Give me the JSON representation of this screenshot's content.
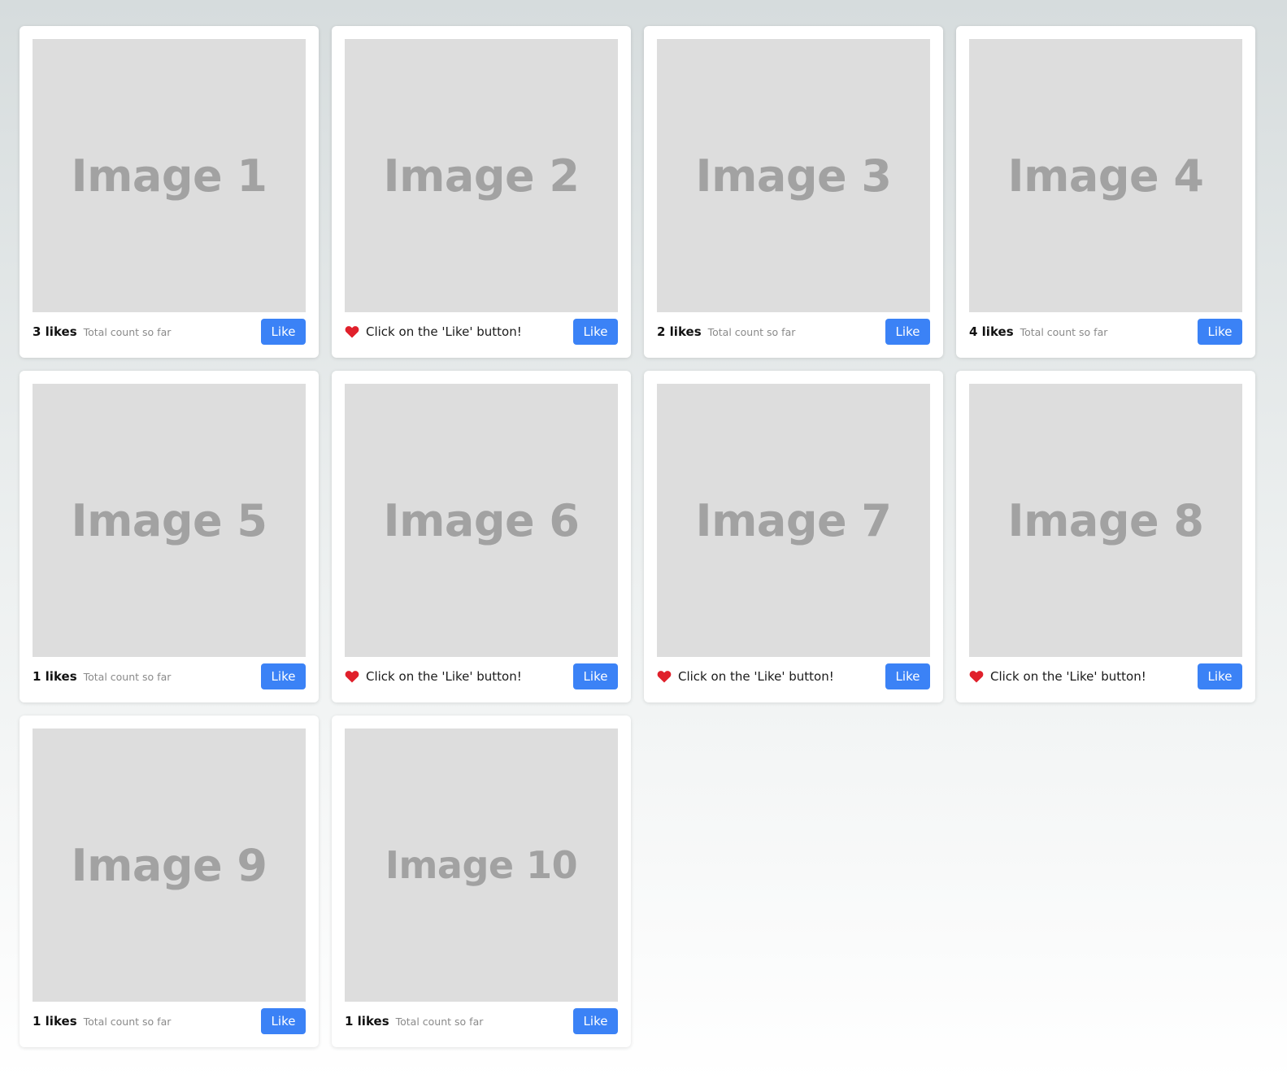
{
  "colors": {
    "like_button": "#3b82f6",
    "heart": "#e0202b",
    "placeholder_bg": "#dddddd",
    "placeholder_text": "#a2a2a2"
  },
  "cards": [
    {
      "image_label": "Image 1",
      "state": "count",
      "count_label": "3 likes",
      "count_sub": "Total count so far",
      "like_label": "Like"
    },
    {
      "image_label": "Image 2",
      "state": "hint",
      "hint_icon": "heart-icon",
      "hint_text": "Click on the 'Like' button!",
      "like_label": "Like"
    },
    {
      "image_label": "Image 3",
      "state": "count",
      "count_label": "2 likes",
      "count_sub": "Total count so far",
      "like_label": "Like"
    },
    {
      "image_label": "Image 4",
      "state": "count",
      "count_label": "4 likes",
      "count_sub": "Total count so far",
      "like_label": "Like"
    },
    {
      "image_label": "Image 5",
      "state": "count",
      "count_label": "1 likes",
      "count_sub": "Total count so far",
      "like_label": "Like"
    },
    {
      "image_label": "Image 6",
      "state": "hint",
      "hint_icon": "heart-icon",
      "hint_text": "Click on the 'Like' button!",
      "like_label": "Like"
    },
    {
      "image_label": "Image 7",
      "state": "hint",
      "hint_icon": "heart-icon",
      "hint_text": "Click on the 'Like' button!",
      "like_label": "Like"
    },
    {
      "image_label": "Image 8",
      "state": "hint",
      "hint_icon": "heart-icon",
      "hint_text": "Click on the 'Like' button!",
      "like_label": "Like"
    },
    {
      "image_label": "Image 9",
      "state": "count",
      "count_label": "1 likes",
      "count_sub": "Total count so far",
      "like_label": "Like"
    },
    {
      "image_label": "Image 10",
      "state": "count",
      "count_label": "1 likes",
      "count_sub": "Total count so far",
      "like_label": "Like"
    }
  ]
}
